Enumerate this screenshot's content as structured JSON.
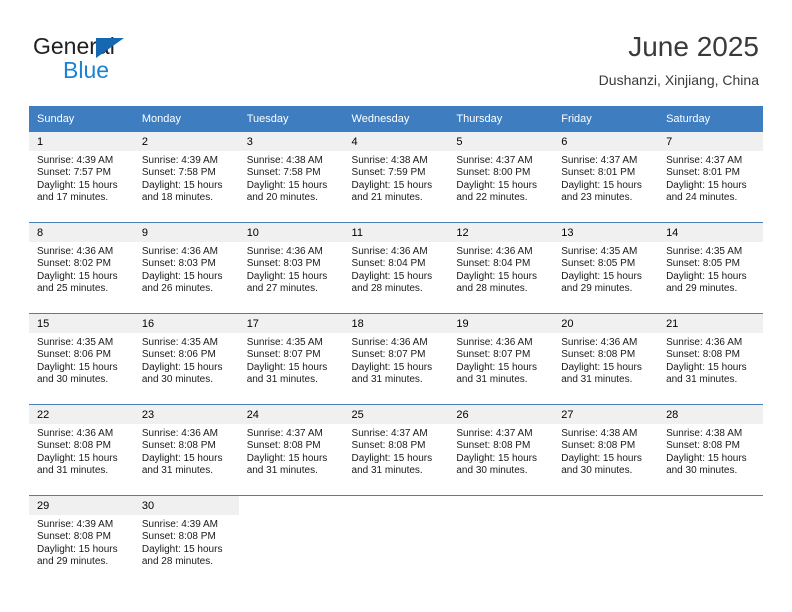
{
  "brand": {
    "name_part1": "General",
    "name_part2": "Blue",
    "triangle_color": "#1668b3",
    "blue_color": "#1b83d4"
  },
  "header": {
    "title": "June 2025",
    "subtitle": "Dushanzi, Xinjiang, China"
  },
  "calendar": {
    "header_bg": "#3d7dc0",
    "daynum_bg": "#f0f0f0",
    "weekday_headers": [
      "Sunday",
      "Monday",
      "Tuesday",
      "Wednesday",
      "Thursday",
      "Friday",
      "Saturday"
    ],
    "weeks": [
      [
        {
          "day": "1",
          "sunrise": "Sunrise: 4:39 AM",
          "sunset": "Sunset: 7:57 PM",
          "daylight_line1": "Daylight: 15 hours",
          "daylight_line2": "and 17 minutes."
        },
        {
          "day": "2",
          "sunrise": "Sunrise: 4:39 AM",
          "sunset": "Sunset: 7:58 PM",
          "daylight_line1": "Daylight: 15 hours",
          "daylight_line2": "and 18 minutes."
        },
        {
          "day": "3",
          "sunrise": "Sunrise: 4:38 AM",
          "sunset": "Sunset: 7:58 PM",
          "daylight_line1": "Daylight: 15 hours",
          "daylight_line2": "and 20 minutes."
        },
        {
          "day": "4",
          "sunrise": "Sunrise: 4:38 AM",
          "sunset": "Sunset: 7:59 PM",
          "daylight_line1": "Daylight: 15 hours",
          "daylight_line2": "and 21 minutes."
        },
        {
          "day": "5",
          "sunrise": "Sunrise: 4:37 AM",
          "sunset": "Sunset: 8:00 PM",
          "daylight_line1": "Daylight: 15 hours",
          "daylight_line2": "and 22 minutes."
        },
        {
          "day": "6",
          "sunrise": "Sunrise: 4:37 AM",
          "sunset": "Sunset: 8:01 PM",
          "daylight_line1": "Daylight: 15 hours",
          "daylight_line2": "and 23 minutes."
        },
        {
          "day": "7",
          "sunrise": "Sunrise: 4:37 AM",
          "sunset": "Sunset: 8:01 PM",
          "daylight_line1": "Daylight: 15 hours",
          "daylight_line2": "and 24 minutes."
        }
      ],
      [
        {
          "day": "8",
          "sunrise": "Sunrise: 4:36 AM",
          "sunset": "Sunset: 8:02 PM",
          "daylight_line1": "Daylight: 15 hours",
          "daylight_line2": "and 25 minutes."
        },
        {
          "day": "9",
          "sunrise": "Sunrise: 4:36 AM",
          "sunset": "Sunset: 8:03 PM",
          "daylight_line1": "Daylight: 15 hours",
          "daylight_line2": "and 26 minutes."
        },
        {
          "day": "10",
          "sunrise": "Sunrise: 4:36 AM",
          "sunset": "Sunset: 8:03 PM",
          "daylight_line1": "Daylight: 15 hours",
          "daylight_line2": "and 27 minutes."
        },
        {
          "day": "11",
          "sunrise": "Sunrise: 4:36 AM",
          "sunset": "Sunset: 8:04 PM",
          "daylight_line1": "Daylight: 15 hours",
          "daylight_line2": "and 28 minutes."
        },
        {
          "day": "12",
          "sunrise": "Sunrise: 4:36 AM",
          "sunset": "Sunset: 8:04 PM",
          "daylight_line1": "Daylight: 15 hours",
          "daylight_line2": "and 28 minutes."
        },
        {
          "day": "13",
          "sunrise": "Sunrise: 4:35 AM",
          "sunset": "Sunset: 8:05 PM",
          "daylight_line1": "Daylight: 15 hours",
          "daylight_line2": "and 29 minutes."
        },
        {
          "day": "14",
          "sunrise": "Sunrise: 4:35 AM",
          "sunset": "Sunset: 8:05 PM",
          "daylight_line1": "Daylight: 15 hours",
          "daylight_line2": "and 29 minutes."
        }
      ],
      [
        {
          "day": "15",
          "sunrise": "Sunrise: 4:35 AM",
          "sunset": "Sunset: 8:06 PM",
          "daylight_line1": "Daylight: 15 hours",
          "daylight_line2": "and 30 minutes."
        },
        {
          "day": "16",
          "sunrise": "Sunrise: 4:35 AM",
          "sunset": "Sunset: 8:06 PM",
          "daylight_line1": "Daylight: 15 hours",
          "daylight_line2": "and 30 minutes."
        },
        {
          "day": "17",
          "sunrise": "Sunrise: 4:35 AM",
          "sunset": "Sunset: 8:07 PM",
          "daylight_line1": "Daylight: 15 hours",
          "daylight_line2": "and 31 minutes."
        },
        {
          "day": "18",
          "sunrise": "Sunrise: 4:36 AM",
          "sunset": "Sunset: 8:07 PM",
          "daylight_line1": "Daylight: 15 hours",
          "daylight_line2": "and 31 minutes."
        },
        {
          "day": "19",
          "sunrise": "Sunrise: 4:36 AM",
          "sunset": "Sunset: 8:07 PM",
          "daylight_line1": "Daylight: 15 hours",
          "daylight_line2": "and 31 minutes."
        },
        {
          "day": "20",
          "sunrise": "Sunrise: 4:36 AM",
          "sunset": "Sunset: 8:08 PM",
          "daylight_line1": "Daylight: 15 hours",
          "daylight_line2": "and 31 minutes."
        },
        {
          "day": "21",
          "sunrise": "Sunrise: 4:36 AM",
          "sunset": "Sunset: 8:08 PM",
          "daylight_line1": "Daylight: 15 hours",
          "daylight_line2": "and 31 minutes."
        }
      ],
      [
        {
          "day": "22",
          "sunrise": "Sunrise: 4:36 AM",
          "sunset": "Sunset: 8:08 PM",
          "daylight_line1": "Daylight: 15 hours",
          "daylight_line2": "and 31 minutes."
        },
        {
          "day": "23",
          "sunrise": "Sunrise: 4:36 AM",
          "sunset": "Sunset: 8:08 PM",
          "daylight_line1": "Daylight: 15 hours",
          "daylight_line2": "and 31 minutes."
        },
        {
          "day": "24",
          "sunrise": "Sunrise: 4:37 AM",
          "sunset": "Sunset: 8:08 PM",
          "daylight_line1": "Daylight: 15 hours",
          "daylight_line2": "and 31 minutes."
        },
        {
          "day": "25",
          "sunrise": "Sunrise: 4:37 AM",
          "sunset": "Sunset: 8:08 PM",
          "daylight_line1": "Daylight: 15 hours",
          "daylight_line2": "and 31 minutes."
        },
        {
          "day": "26",
          "sunrise": "Sunrise: 4:37 AM",
          "sunset": "Sunset: 8:08 PM",
          "daylight_line1": "Daylight: 15 hours",
          "daylight_line2": "and 30 minutes."
        },
        {
          "day": "27",
          "sunrise": "Sunrise: 4:38 AM",
          "sunset": "Sunset: 8:08 PM",
          "daylight_line1": "Daylight: 15 hours",
          "daylight_line2": "and 30 minutes."
        },
        {
          "day": "28",
          "sunrise": "Sunrise: 4:38 AM",
          "sunset": "Sunset: 8:08 PM",
          "daylight_line1": "Daylight: 15 hours",
          "daylight_line2": "and 30 minutes."
        }
      ],
      [
        {
          "day": "29",
          "sunrise": "Sunrise: 4:39 AM",
          "sunset": "Sunset: 8:08 PM",
          "daylight_line1": "Daylight: 15 hours",
          "daylight_line2": "and 29 minutes."
        },
        {
          "day": "30",
          "sunrise": "Sunrise: 4:39 AM",
          "sunset": "Sunset: 8:08 PM",
          "daylight_line1": "Daylight: 15 hours",
          "daylight_line2": "and 28 minutes."
        },
        {
          "day": "",
          "sunrise": "",
          "sunset": "",
          "daylight_line1": "",
          "daylight_line2": ""
        },
        {
          "day": "",
          "sunrise": "",
          "sunset": "",
          "daylight_line1": "",
          "daylight_line2": ""
        },
        {
          "day": "",
          "sunrise": "",
          "sunset": "",
          "daylight_line1": "",
          "daylight_line2": ""
        },
        {
          "day": "",
          "sunrise": "",
          "sunset": "",
          "daylight_line1": "",
          "daylight_line2": ""
        },
        {
          "day": "",
          "sunrise": "",
          "sunset": "",
          "daylight_line1": "",
          "daylight_line2": ""
        }
      ]
    ]
  }
}
